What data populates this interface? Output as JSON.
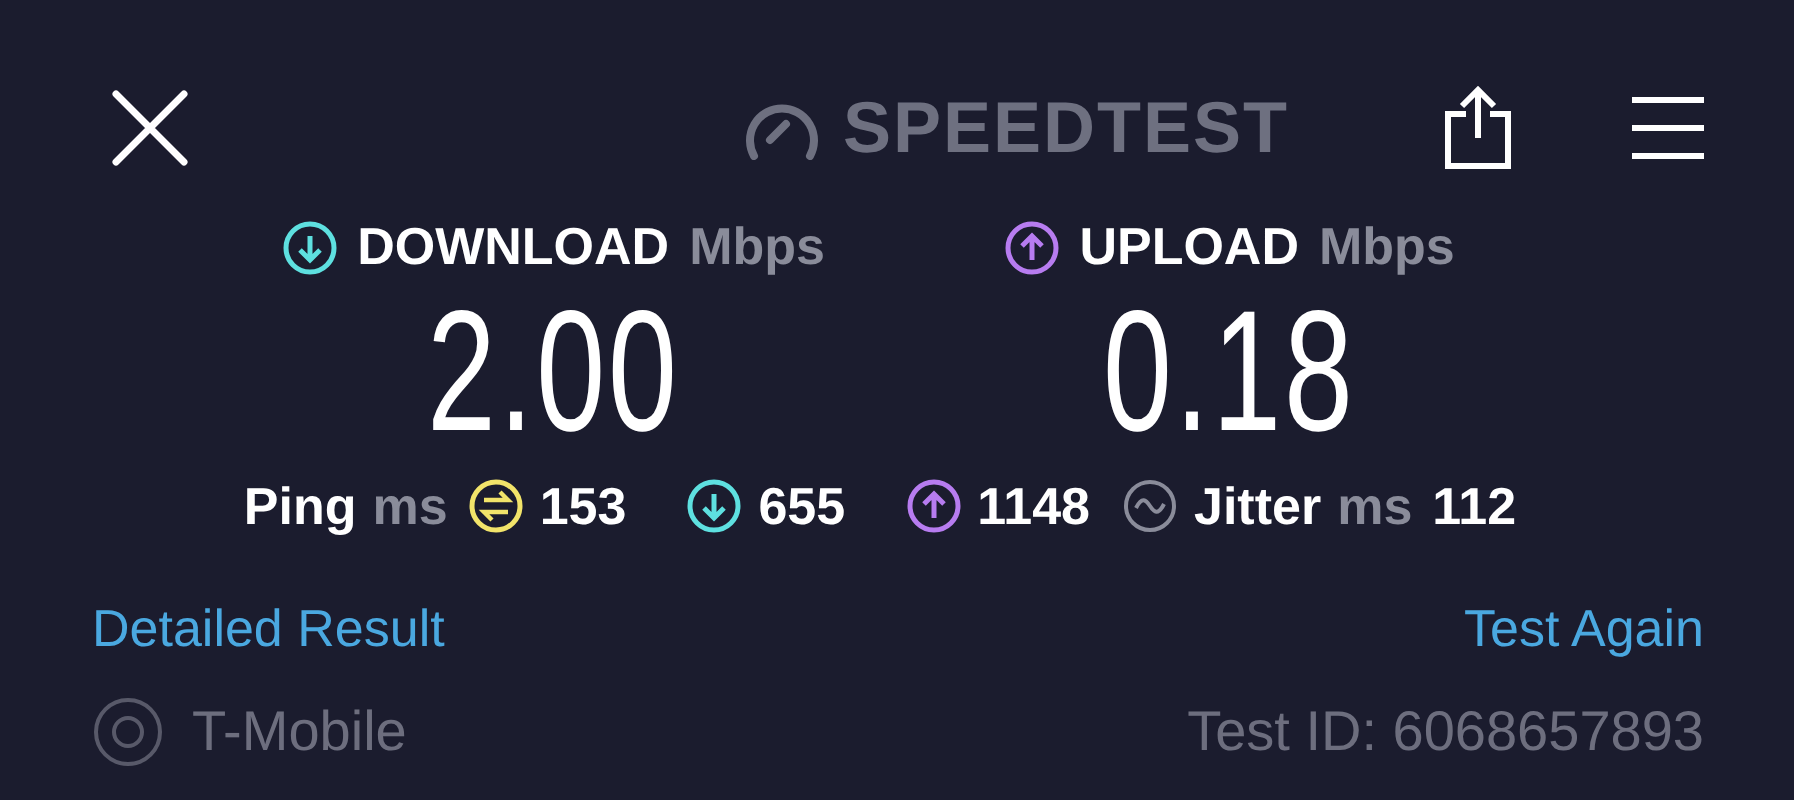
{
  "header": {
    "logo": "SPEEDTEST"
  },
  "results": [
    {
      "kind": "download",
      "label": "DOWNLOAD",
      "unit": "Mbps",
      "value": "2.00"
    },
    {
      "kind": "upload",
      "label": "UPLOAD",
      "unit": "Mbps",
      "value": "0.18"
    }
  ],
  "ping": {
    "label": "Ping",
    "unit": "ms",
    "idle": "153",
    "download": "655",
    "upload": "1148"
  },
  "jitter": {
    "label": "Jitter",
    "unit": "ms",
    "value": "112"
  },
  "links": [
    "Detailed Result",
    "Test Again"
  ],
  "footer": {
    "provider": "T-Mobile",
    "test_id": "Test ID: 6068657893"
  }
}
